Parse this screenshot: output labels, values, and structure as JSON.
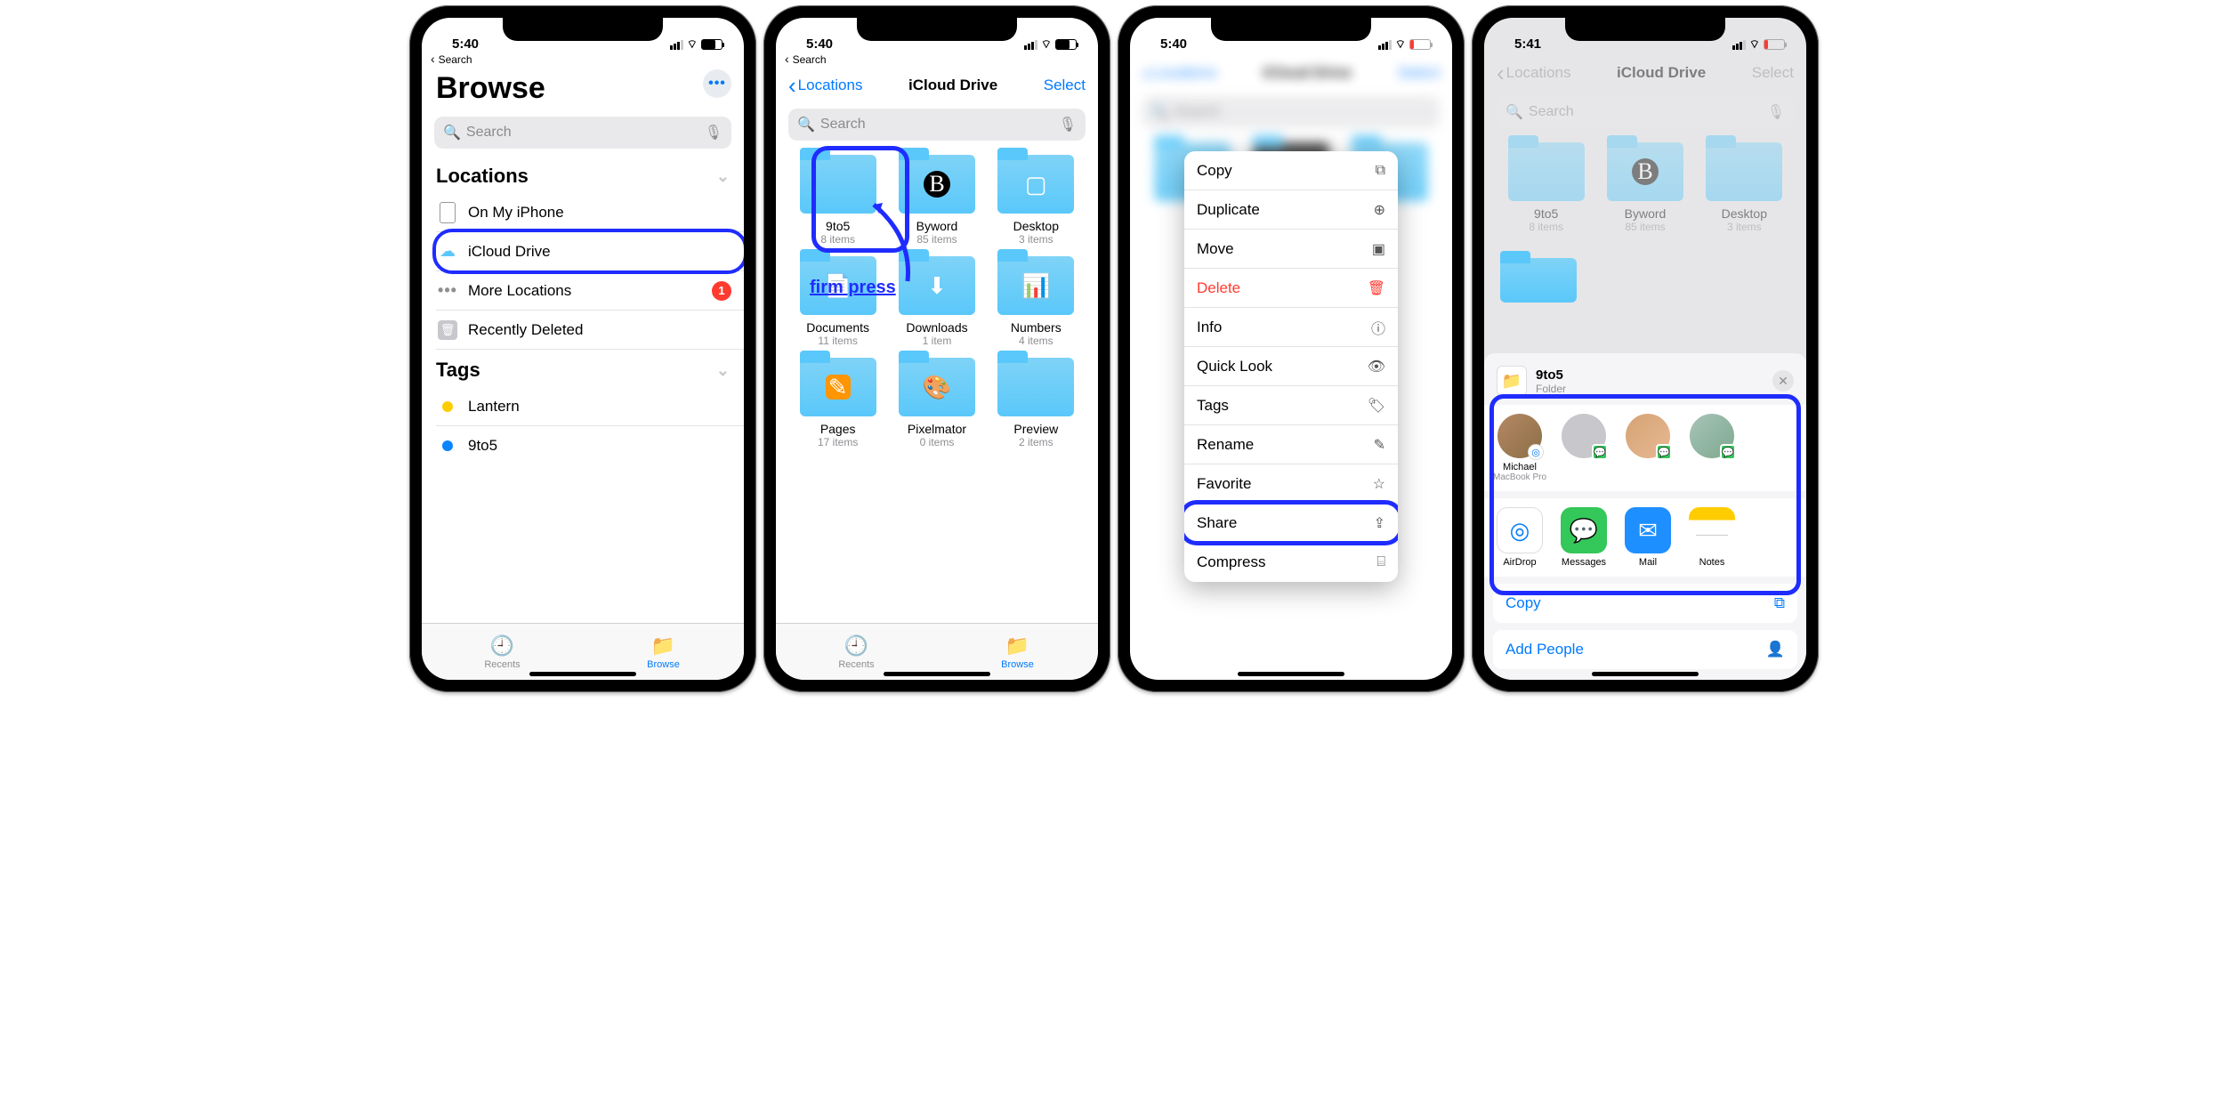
{
  "phone1": {
    "time": "5:40",
    "back_crumb": "Search",
    "title": "Browse",
    "search_placeholder": "Search",
    "more_dots": "•••",
    "sections": {
      "locations_label": "Locations",
      "tags_label": "Tags"
    },
    "rows": {
      "on_my_iphone": "On My iPhone",
      "icloud_drive": "iCloud Drive",
      "more_locations": "More Locations",
      "more_locations_badge": "1",
      "recently_deleted": "Recently Deleted",
      "lantern": "Lantern",
      "nine_to_five": "9to5"
    },
    "tabs": {
      "recents": "Recents",
      "browse": "Browse"
    }
  },
  "phone2": {
    "time": "5:40",
    "back_crumb": "Search",
    "nav_back": "Locations",
    "nav_title": "iCloud Drive",
    "nav_right": "Select",
    "search_placeholder": "Search",
    "annotation": "firm press",
    "folders": [
      {
        "name": "9to5",
        "sub": "8 items",
        "key": "f0"
      },
      {
        "name": "Byword",
        "sub": "85 items",
        "key": "f1",
        "ov": "B"
      },
      {
        "name": "Desktop",
        "sub": "3 items",
        "key": "f2",
        "ov": "win"
      },
      {
        "name": "Documents",
        "sub": "11 items",
        "key": "f3",
        "ov": "doc"
      },
      {
        "name": "Downloads",
        "sub": "1 item",
        "key": "f4",
        "ov": "down"
      },
      {
        "name": "Numbers",
        "sub": "4 items",
        "key": "f5",
        "ov": "num"
      },
      {
        "name": "Pages",
        "sub": "17 items",
        "key": "f6",
        "ov": "pages"
      },
      {
        "name": "Pixelmator",
        "sub": "0 items",
        "key": "f7",
        "ov": "pix"
      },
      {
        "name": "Preview",
        "sub": "2 items",
        "key": "f8"
      }
    ],
    "tabs": {
      "recents": "Recents",
      "browse": "Browse"
    }
  },
  "phone3": {
    "time": "5:40",
    "context_items": [
      {
        "label": "Copy",
        "icon": "⧉"
      },
      {
        "label": "Duplicate",
        "icon": "⊕"
      },
      {
        "label": "Move",
        "icon": "▣"
      },
      {
        "label": "Delete",
        "icon": "🗑",
        "destr": true
      },
      {
        "label": "Info",
        "icon": "ⓘ"
      },
      {
        "label": "Quick Look",
        "icon": "👁"
      },
      {
        "label": "Tags",
        "icon": "🏷"
      },
      {
        "label": "Rename",
        "icon": "✎"
      },
      {
        "label": "Favorite",
        "icon": "☆"
      },
      {
        "label": "Share",
        "icon": "⇪",
        "hl": true
      },
      {
        "label": "Compress",
        "icon": "⌸"
      }
    ]
  },
  "phone4": {
    "time": "5:41",
    "nav_back": "Locations",
    "nav_title": "iCloud Drive",
    "nav_right": "Select",
    "search_placeholder": "Search",
    "folders": [
      {
        "name": "9to5",
        "sub": "8 items"
      },
      {
        "name": "Byword",
        "sub": "85 items",
        "ov": "B"
      },
      {
        "name": "Desktop",
        "sub": "3 items"
      }
    ],
    "sheet": {
      "title": "9to5",
      "subtitle": "Folder",
      "people": [
        {
          "name": "Michael",
          "sub": "MacBook Pro",
          "badge": "air"
        },
        {
          "name": "",
          "sub": "",
          "badge": "msg"
        },
        {
          "name": "",
          "sub": "",
          "badge": "msg"
        },
        {
          "name": "",
          "sub": "",
          "badge": "msg"
        }
      ],
      "apps": [
        {
          "name": "AirDrop",
          "cls": "a-air",
          "glyph": "◎"
        },
        {
          "name": "Messages",
          "cls": "a-msg",
          "glyph": "💬"
        },
        {
          "name": "Mail",
          "cls": "a-mail",
          "glyph": "✉"
        },
        {
          "name": "Notes",
          "cls": "a-notes",
          "glyph": ""
        }
      ],
      "actions": {
        "copy": "Copy",
        "add_people": "Add People"
      }
    }
  }
}
